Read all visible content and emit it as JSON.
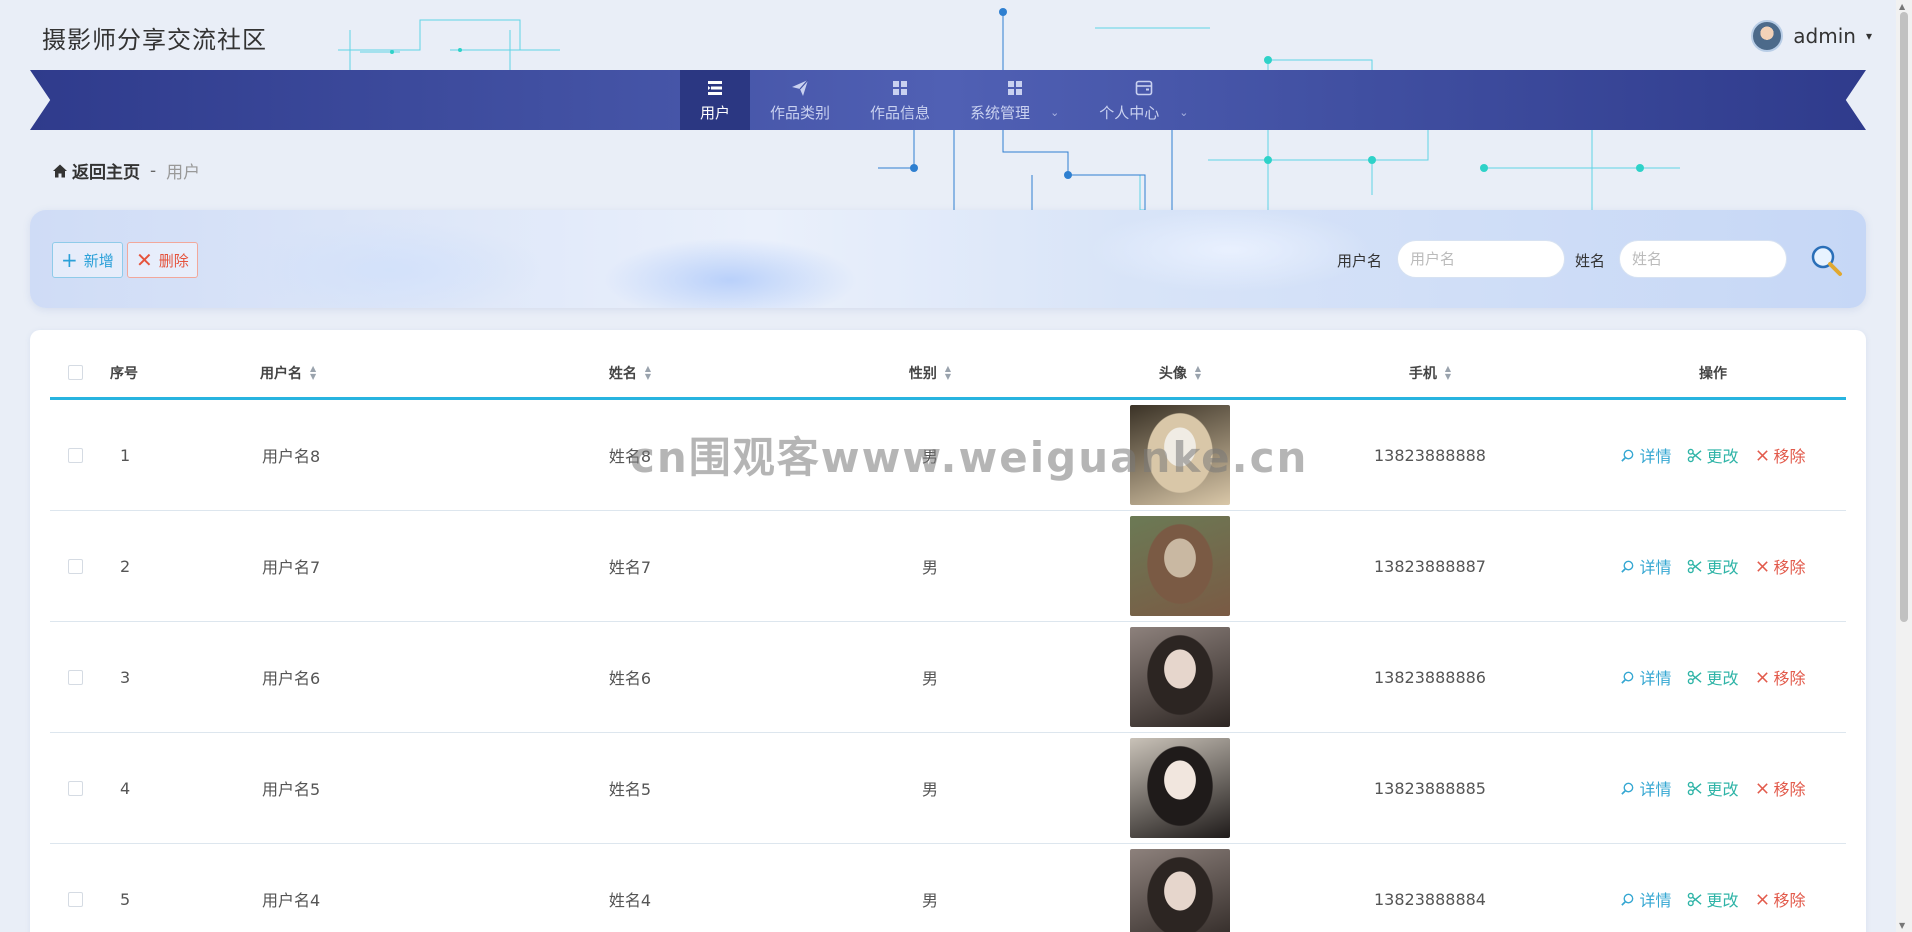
{
  "site": {
    "title": "摄影师分享交流社区"
  },
  "user_menu": {
    "username": "admin",
    "caret": "▾"
  },
  "nav": {
    "items": [
      {
        "label": "用户",
        "active": true,
        "has_submenu": false,
        "icon": "list-icon"
      },
      {
        "label": "作品类别",
        "active": false,
        "has_submenu": false,
        "icon": "paper-plane-icon"
      },
      {
        "label": "作品信息",
        "active": false,
        "has_submenu": false,
        "icon": "grid-icon"
      },
      {
        "label": "系统管理",
        "active": false,
        "has_submenu": true,
        "icon": "grid-icon"
      },
      {
        "label": "个人中心",
        "active": false,
        "has_submenu": true,
        "icon": "wallet-icon"
      }
    ],
    "submenu_arrow": "⌄"
  },
  "breadcrumb": {
    "home": "返回主页",
    "separator": "-",
    "current": "用户"
  },
  "toolbar": {
    "add_label": "新增",
    "add_symbol": "+",
    "delete_label": "删除",
    "delete_symbol": "✕",
    "username_label": "用户名",
    "username_placeholder": "用户名",
    "name_label": "姓名",
    "name_placeholder": "姓名"
  },
  "table": {
    "headers": {
      "index": "序号",
      "username": "用户名",
      "name": "姓名",
      "gender": "性别",
      "avatar": "头像",
      "phone": "手机",
      "actions": "操作"
    },
    "action_labels": {
      "detail": "详情",
      "edit": "更改",
      "remove": "移除"
    },
    "rows": [
      {
        "index": "1",
        "username": "用户名8",
        "name": "姓名8",
        "gender": "男",
        "phone": "13823888888",
        "avatar": "photo-avatar"
      },
      {
        "index": "2",
        "username": "用户名7",
        "name": "姓名7",
        "gender": "男",
        "phone": "13823888887",
        "avatar": "photo-avatar"
      },
      {
        "index": "3",
        "username": "用户名6",
        "name": "姓名6",
        "gender": "男",
        "phone": "13823888886",
        "avatar": "photo-avatar"
      },
      {
        "index": "4",
        "username": "用户名5",
        "name": "姓名5",
        "gender": "男",
        "phone": "13823888885",
        "avatar": "photo-avatar"
      },
      {
        "index": "5",
        "username": "用户名4",
        "name": "姓名4",
        "gender": "男",
        "phone": "13823888884",
        "avatar": "photo-avatar"
      }
    ]
  },
  "watermark": "cn围观客www.weiguanke.cn",
  "colors": {
    "nav_bg": "#3f4ea0",
    "nav_active": "#2b3782",
    "accent": "#27b4e0",
    "detail": "#35a7d2",
    "edit": "#2fb4a7",
    "remove": "#e25a4b"
  }
}
